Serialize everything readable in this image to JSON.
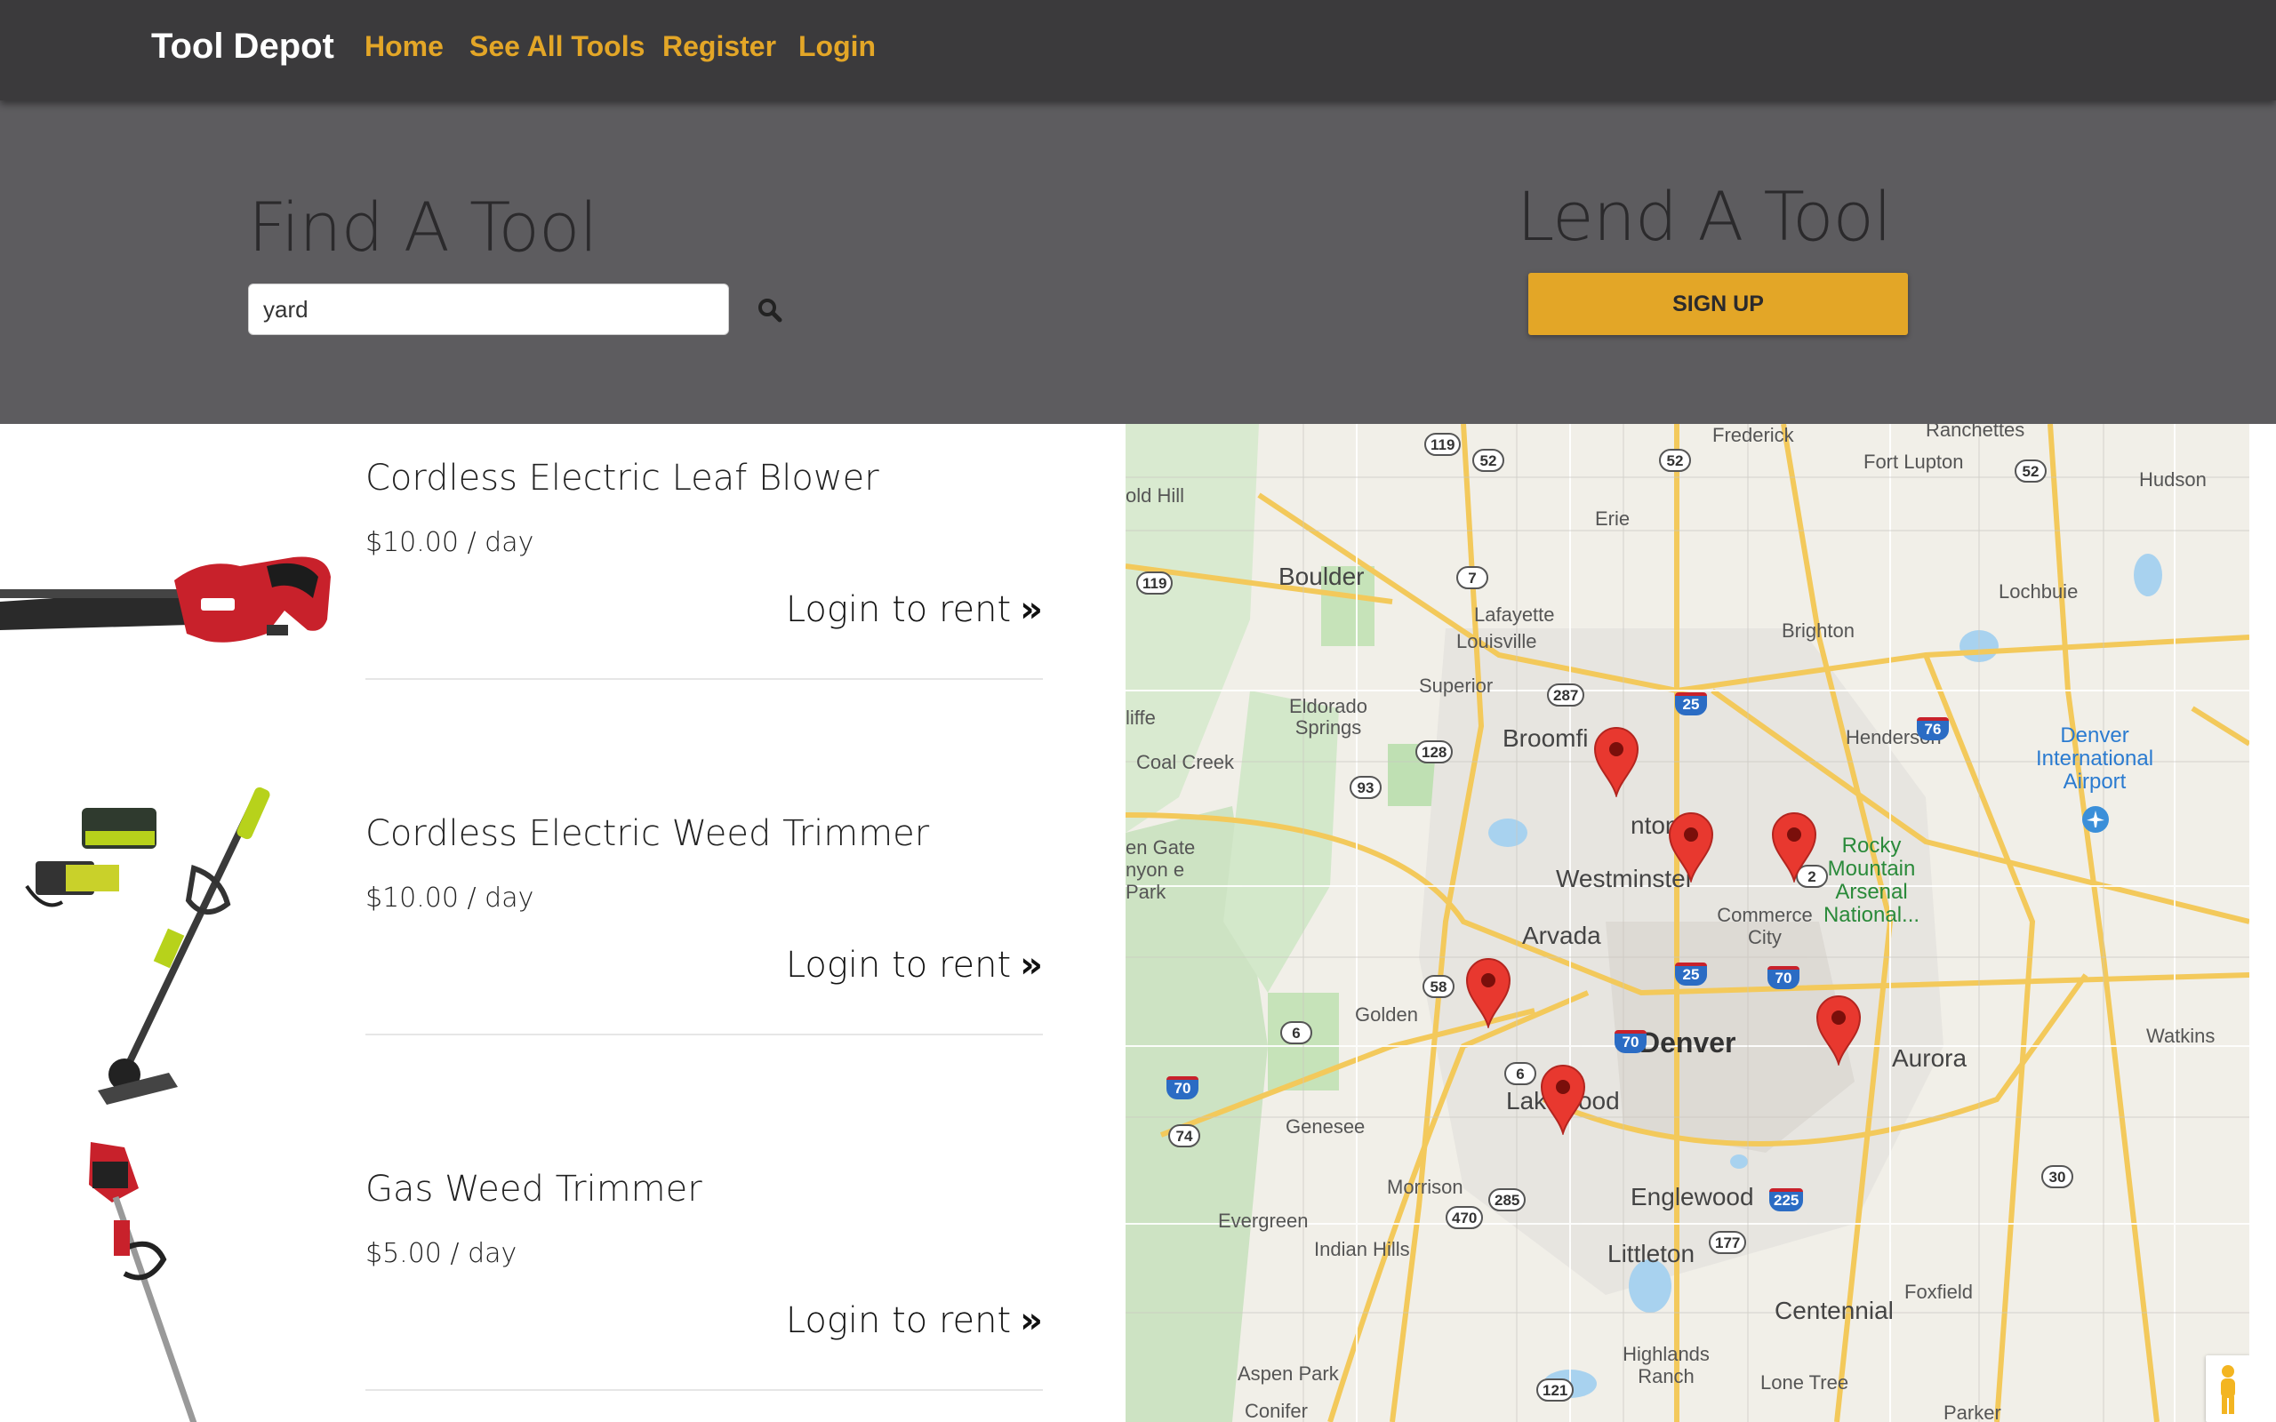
{
  "nav": {
    "brand": "Tool Depot",
    "links": [
      "Home",
      "See All Tools",
      "Register",
      "Login"
    ]
  },
  "hero": {
    "find_title": "Find A Tool",
    "search_value": "yard",
    "search_icon": "search-icon",
    "lend_title": "Lend A Tool",
    "signup_label": "SIGN UP"
  },
  "tools": [
    {
      "name": "Cordless Electric Leaf Blower",
      "price": "$10.00 / day",
      "action": "Login to rent",
      "action_icon": "double-chevron-right-icon"
    },
    {
      "name": "Cordless Electric Weed Trimmer",
      "price": "$10.00 / day",
      "action": "Login to rent",
      "action_icon": "double-chevron-right-icon"
    },
    {
      "name": "Gas Weed Trimmer",
      "price": "$5.00 / day",
      "action": "Login to rent",
      "action_icon": "double-chevron-right-icon"
    }
  ],
  "map": {
    "labels": {
      "frederick": "Frederick",
      "ranchettes": "Ranchettes",
      "fort_lupton": "Fort Lupton",
      "hudson": "Hudson",
      "gold_hill": "old Hill",
      "erie": "Erie",
      "boulder": "Boulder",
      "lochbuie": "Lochbuie",
      "lafayette": "Lafayette",
      "louisville": "Louisville",
      "brighton": "Brighton",
      "superior": "Superior",
      "eldorado": "Eldorado Springs",
      "cliffe": "liffe",
      "broomfield": "Broomfi",
      "henderson": "Henderson",
      "denver_airport": "Denver International Airport",
      "coal_creek": "Coal Creek",
      "thornton": "nton",
      "golden_gate": "en Gate nyon e Park",
      "rocky_mountain": "Rocky Mountain Arsenal National...",
      "westminster": "Westminster",
      "commerce_city": "Commerce City",
      "arvada": "Arvada",
      "golden": "Golden",
      "denver": "Denver",
      "watkins": "Watkins",
      "aurora": "Aurora",
      "lakewood": "Lakewood",
      "genesee": "Genesee",
      "morrison": "Morrison",
      "englewood": "Englewood",
      "evergreen": "Evergreen",
      "indian_hills": "Indian Hills",
      "littleton": "Littleton",
      "foxfield": "Foxfield",
      "centennial": "Centennial",
      "highlands_ranch": "Highlands Ranch",
      "aspen_park": "Aspen Park",
      "lone_tree": "Lone Tree",
      "conifer": "Conifer",
      "parker": "Parker"
    },
    "shields": [
      "119",
      "52",
      "52",
      "52",
      "7",
      "119",
      "287",
      "25",
      "76",
      "128",
      "93",
      "2",
      "25",
      "70",
      "58",
      "6",
      "70",
      "6",
      "70",
      "74",
      "285",
      "470",
      "177",
      "225",
      "30",
      "121"
    ],
    "pin_icon": "map-marker-icon",
    "pegman_icon": "street-view-pegman-icon"
  }
}
